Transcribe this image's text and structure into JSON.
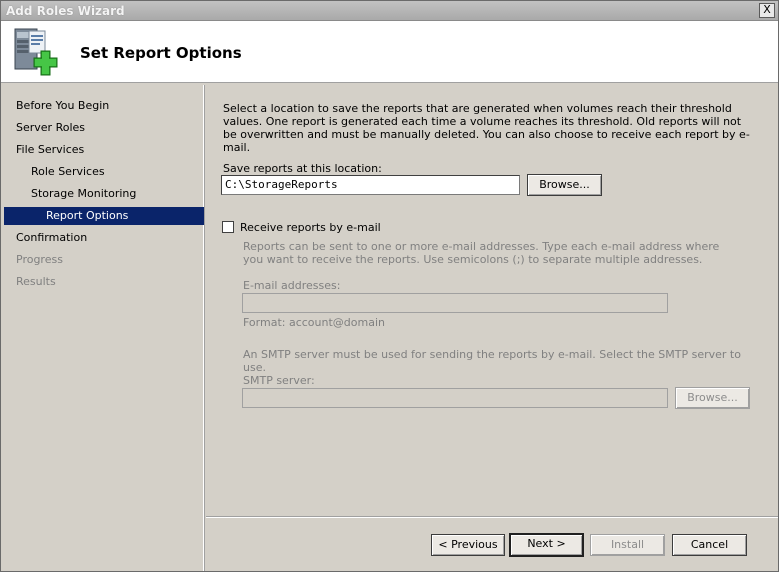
{
  "window": {
    "title": "Add Roles Wizard",
    "close_glyph": "X"
  },
  "header": {
    "title": "Set Report Options",
    "icon": "server-roles-add-icon"
  },
  "nav": {
    "items": [
      {
        "label": "Before You Begin",
        "state": "normal",
        "level": 0
      },
      {
        "label": "Server Roles",
        "state": "normal",
        "level": 0
      },
      {
        "label": "File Services",
        "state": "normal",
        "level": 0
      },
      {
        "label": "Role Services",
        "state": "normal",
        "level": 1
      },
      {
        "label": "Storage Monitoring",
        "state": "normal",
        "level": 1
      },
      {
        "label": "Report Options",
        "state": "active",
        "level": 2
      },
      {
        "label": "Confirmation",
        "state": "normal",
        "level": 0
      },
      {
        "label": "Progress",
        "state": "disabled",
        "level": 0
      },
      {
        "label": "Results",
        "state": "disabled",
        "level": 0
      }
    ]
  },
  "main": {
    "description": "Select a location to save the reports that are generated when volumes reach their threshold values. One report is generated each time a volume reaches its threshold. Old reports will not be overwritten and must be manually deleted. You can also choose to receive each report by e-mail.",
    "save_location_label": "Save reports at this location:",
    "save_location_value": "C:\\StorageReports",
    "browse_label": "Browse...",
    "email_checkbox_label": "Receive reports by e-mail",
    "email_checkbox_checked": false,
    "email_help": "Reports can be sent to one or more e-mail addresses. Type each e-mail address where you want to receive the reports. Use semicolons (;) to separate multiple addresses.",
    "email_addresses_label": "E-mail addresses:",
    "email_addresses_value": "",
    "email_format_hint": "Format: account@domain",
    "smtp_help": "An SMTP server must be used for sending the reports by e-mail. Select the SMTP server to use.",
    "smtp_label": "SMTP server:",
    "smtp_value": "",
    "smtp_browse_label": "Browse..."
  },
  "footer": {
    "previous_label": "< Previous",
    "next_label": "Next >",
    "install_label": "Install",
    "cancel_label": "Cancel"
  },
  "colors": {
    "active_nav": "#0a246a",
    "disabled_text": "#808080",
    "dialog_bg": "#d4d0c8"
  }
}
